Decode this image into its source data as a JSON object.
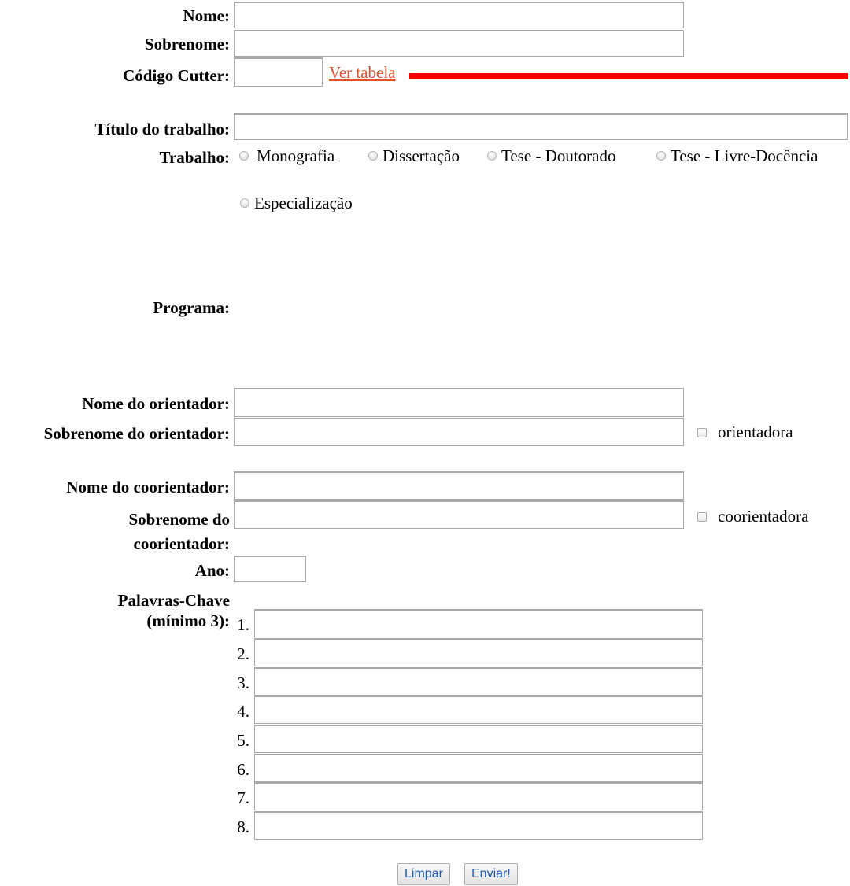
{
  "fields": {
    "nome": {
      "label": "Nome:",
      "value": ""
    },
    "sobrenome": {
      "label": "Sobrenome:",
      "value": ""
    },
    "cutter": {
      "label": "Código Cutter:",
      "value": "",
      "link": "Ver tabela"
    },
    "titulo": {
      "label": "Título do trabalho:",
      "value": ""
    },
    "trabalho": {
      "label": "Trabalho:",
      "options": [
        "Monografia",
        "Dissertação",
        "Tese - Doutorado",
        "Tese - Livre-Docência",
        "Especialização"
      ]
    },
    "programa": {
      "label": "Programa:"
    },
    "orientador_nome": {
      "label": "Nome do orientador:",
      "value": ""
    },
    "orientador_sobrenome": {
      "label": "Sobrenome do orientador:",
      "value": ""
    },
    "orientadora_check": {
      "label": "orientadora",
      "checked": false
    },
    "coorientador_nome": {
      "label": "Nome do coorientador:",
      "value": ""
    },
    "coorientador_sobrenome": {
      "label_line1": "Sobrenome do",
      "label_line2": "coorientador:",
      "value": ""
    },
    "coorientadora_check": {
      "label": "coorientadora",
      "checked": false
    },
    "ano": {
      "label": "Ano:",
      "value": ""
    },
    "palavras": {
      "label_line1": "Palavras-Chave",
      "label_line2": "(mínimo 3):",
      "numbers": [
        "1.",
        "2.",
        "3.",
        "4.",
        "5.",
        "6.",
        "7.",
        "8."
      ]
    }
  },
  "buttons": {
    "clear": "Limpar",
    "submit": "Enviar!"
  },
  "colors": {
    "link": "#e2502a",
    "annotation": "#f40000",
    "button_text": "#1e5fb8"
  }
}
